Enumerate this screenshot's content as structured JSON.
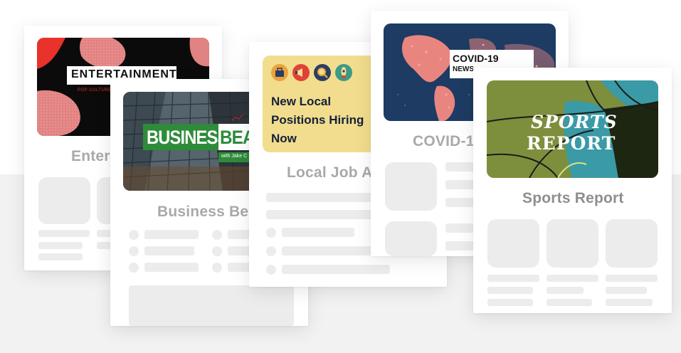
{
  "background": {
    "top": "#ffffff",
    "band": "#f2f2f2"
  },
  "placeholder_color": "#ececec",
  "cards": {
    "entertainment": {
      "thumb_title": "ENTERTAINMENT",
      "thumb_subtitle": "POP CULTURE N",
      "title": "Enter",
      "colors": {
        "bg": "#0b0b0b",
        "blob": "#e28383",
        "accent": "#e8322b"
      }
    },
    "business": {
      "thumb_word1": "BUSINESS",
      "thumb_word2": "BEA",
      "thumb_byline": "with Jake C",
      "title": "Business Be",
      "colors": {
        "banner": "#2e8b3a"
      }
    },
    "jobs": {
      "thumb_headline_1": "New Local",
      "thumb_headline_2": "Positions Hiring",
      "thumb_headline_3": "Now",
      "icons": [
        "briefcase-icon",
        "megaphone-icon",
        "magnifier-icon",
        "rocket-icon"
      ],
      "title": "Local Job A",
      "colors": {
        "bg": "#f1dd8d"
      }
    },
    "covid": {
      "thumb_title": "COVID-19",
      "thumb_subtitle": "NEWS",
      "title": "COVID-1",
      "colors": {
        "map": "#1d3b63",
        "land": "#e9857f"
      }
    },
    "sports": {
      "thumb_line1": "SPORTS",
      "thumb_line2": "REPORT",
      "title": "Sports Report",
      "colors": {
        "olive": "#7d8f3c",
        "teal": "#3a9aa6",
        "dark": "#1d2610"
      }
    }
  }
}
